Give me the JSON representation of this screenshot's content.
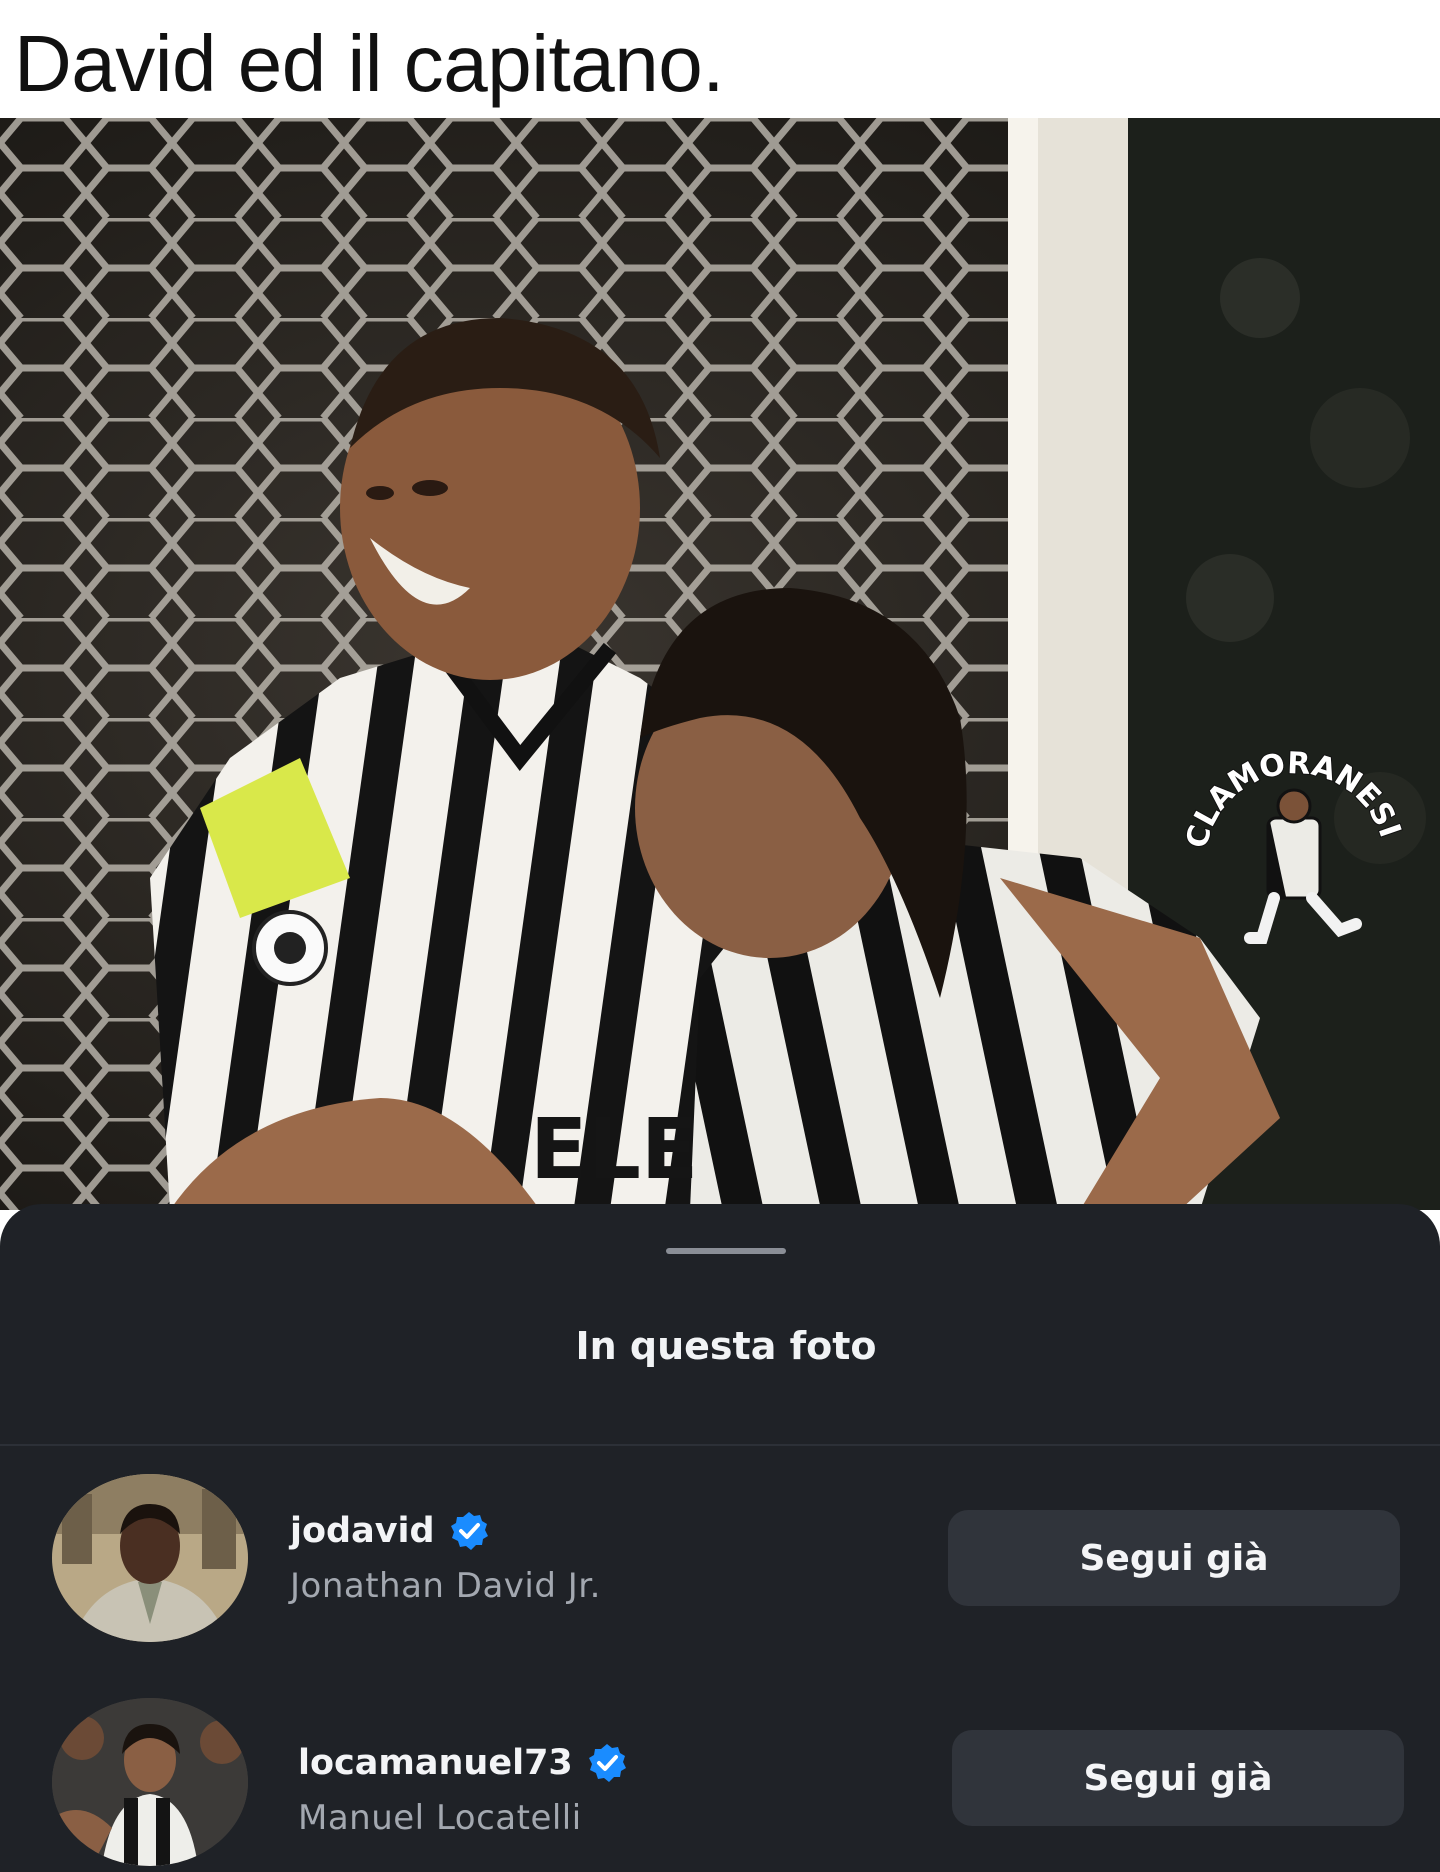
{
  "caption": "David ed il capitano.",
  "photo": {
    "watermark_text": "CLAMORANESI",
    "shirt_text": "ELE"
  },
  "sheet": {
    "title": "In questa foto",
    "people": [
      {
        "username": "jodavid",
        "full_name": "Jonathan David Jr.",
        "verified": true,
        "button_label": "Segui già"
      },
      {
        "username": "locamanuel73",
        "full_name": "Manuel Locatelli",
        "verified": true,
        "button_label": "Segui già"
      }
    ]
  },
  "colors": {
    "sheet_bg": "#1f2227",
    "button_bg": "#30343b",
    "verified_blue": "#1a8cff"
  }
}
